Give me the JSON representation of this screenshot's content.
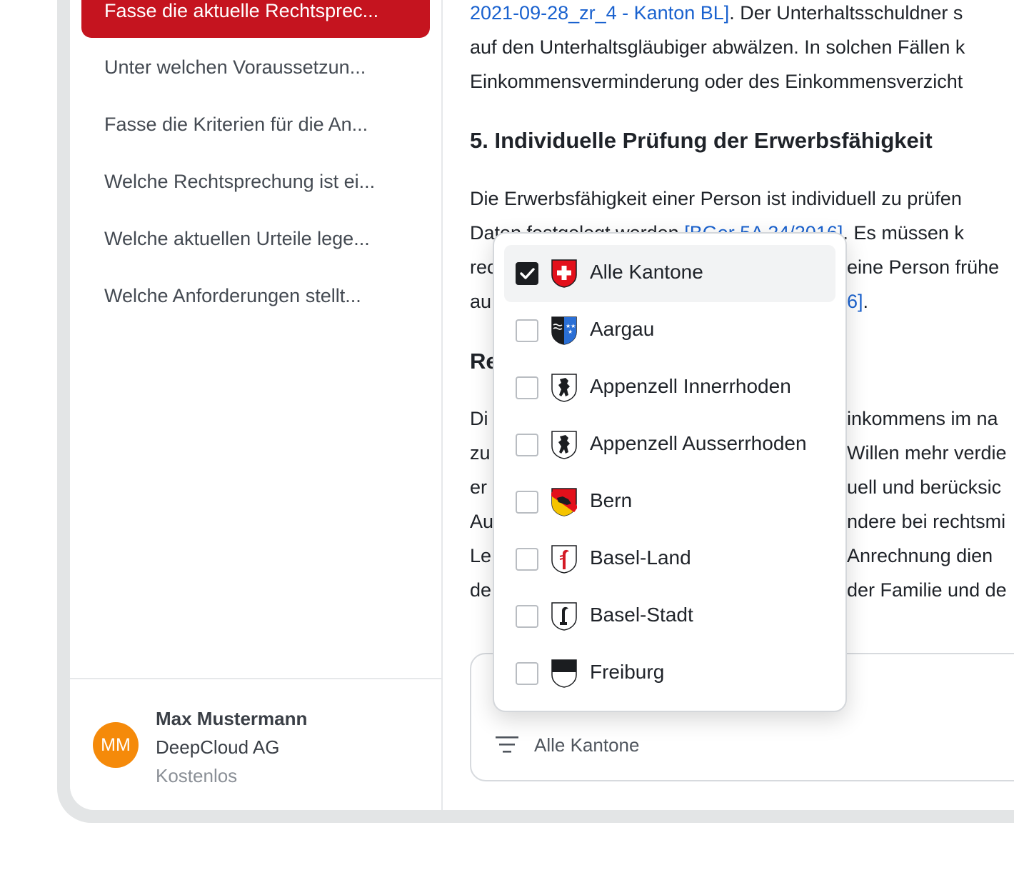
{
  "sidebar": {
    "active_item": "Fasse die aktuelle Rechtsprec...",
    "history": [
      "Unter welchen Voraussetzun...",
      "Fasse die Kriterien für die An...",
      "Welche Rechtsprechung ist ei...",
      "Welche aktuellen Urteile lege...",
      "Welche Anforderungen stellt..."
    ],
    "user": {
      "initials": "MM",
      "name": "Max Mustermann",
      "company": "DeepCloud AG",
      "plan": "Kostenlos"
    }
  },
  "content": {
    "line1_link": "2021-09-28_zr_4 - Kanton BL]",
    "line1_text": ". Der Unterhaltsschuldner s",
    "line2": "auf den Unterhaltsgläubiger abwälzen. In solchen Fällen k",
    "line3": "Einkommensverminderung oder des Einkommensverzicht",
    "heading": "5. Individuelle Prüfung der Erwerbsfähigkeit",
    "p_line1": "Die Erwerbsfähigkeit einer Person ist individuell zu prüfen",
    "p_line2_start": "Daten festgelegt werden ",
    "p_line2_link": "[BGer 5A 24/2016]",
    "p_line2_end": ". Es müssen k",
    "p_line3_start": "rec",
    "p_line3_end": "eine Person frühe",
    "p_line4_start": "au",
    "p_line4_link": "6]",
    "p_line4_end": ".",
    "heading2_start": "Re",
    "q_lines_start": [
      "Di",
      "zu",
      "er",
      "Au",
      "Le",
      "de"
    ],
    "q_lines_end": [
      "inkommens im na",
      "Willen mehr verdie",
      "uell und berücksic",
      "ndere bei rechtsmi",
      "Anrechnung dien",
      "der Familie und de"
    ]
  },
  "composer": {
    "filter_label": "Alle Kantone"
  },
  "dropdown": {
    "options": [
      {
        "label": "Alle Kantone",
        "checked": true,
        "crest": "swiss-cross-icon"
      },
      {
        "label": "Aargau",
        "checked": false,
        "crest": "aargau-crest-icon"
      },
      {
        "label": "Appenzell Innerrhoden",
        "checked": false,
        "crest": "appenzell-innerrhoden-crest-icon"
      },
      {
        "label": "Appenzell Ausserrhoden",
        "checked": false,
        "crest": "appenzell-ausserrhoden-crest-icon"
      },
      {
        "label": "Bern",
        "checked": false,
        "crest": "bern-crest-icon"
      },
      {
        "label": "Basel-Land",
        "checked": false,
        "crest": "basel-land-crest-icon"
      },
      {
        "label": "Basel-Stadt",
        "checked": false,
        "crest": "basel-stadt-crest-icon"
      },
      {
        "label": "Freiburg",
        "checked": false,
        "crest": "freiburg-crest-icon"
      }
    ]
  },
  "colors": {
    "brand_red": "#c5141f",
    "link": "#1a62cf",
    "avatar": "#f58a0a"
  }
}
